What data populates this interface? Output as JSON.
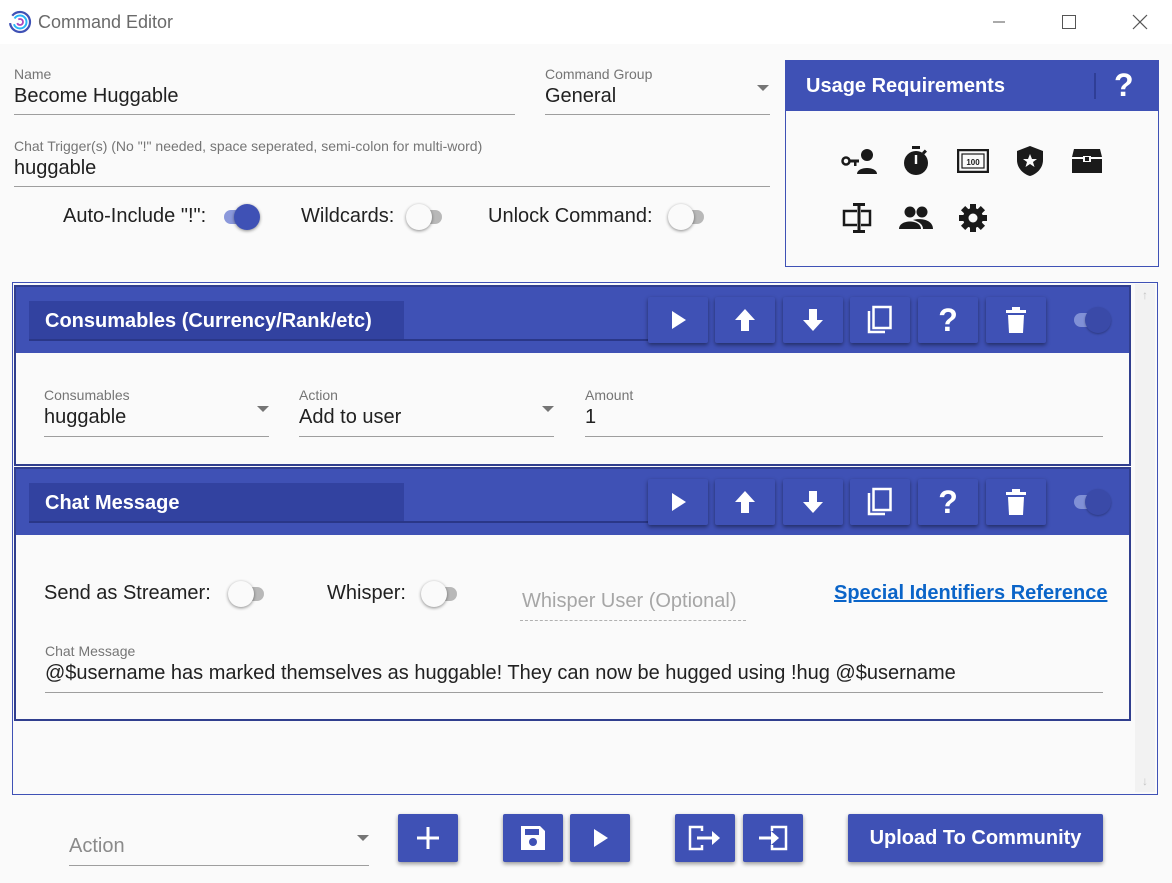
{
  "window": {
    "title": "Command Editor",
    "app_icon": "mix-it-up-logo",
    "controls": [
      "minimize-icon",
      "maximize-icon",
      "close-icon"
    ]
  },
  "command": {
    "name_label": "Name",
    "name_value": "Become Huggable",
    "group_label": "Command Group",
    "group_value": "General",
    "trigger_label": "Chat Trigger(s) (No \"!\" needed, space seperated, semi-colon for multi-word)",
    "trigger_value": "huggable",
    "options": [
      {
        "label": "Auto-Include \"!\":",
        "on": true
      },
      {
        "label": "Wildcards:",
        "on": false
      },
      {
        "label": "Unlock Command:",
        "on": false
      }
    ]
  },
  "usage_requirements": {
    "title": "Usage Requirements",
    "help": "?",
    "icons": [
      "role-icon",
      "cooldown-timer-icon",
      "currency-icon",
      "rank-badge-icon",
      "inventory-chest-icon",
      "arguments-icon",
      "threshold-users-icon",
      "settings-icon"
    ]
  },
  "actions": [
    {
      "title": "Consumables (Currency/Rank/etc)",
      "tools": [
        "play-icon",
        "move-up-icon",
        "move-down-icon",
        "duplicate-icon",
        "help-icon",
        "delete-icon"
      ],
      "enabled": true,
      "fields": {
        "consumable_label": "Consumables",
        "consumable_value": "huggable",
        "action_label": "Action",
        "action_value": "Add to user",
        "amount_label": "Amount",
        "amount_value": "1"
      }
    },
    {
      "title": "Chat Message",
      "tools": [
        "play-icon",
        "move-up-icon",
        "move-down-icon",
        "duplicate-icon",
        "help-icon",
        "delete-icon"
      ],
      "enabled": true,
      "fields": {
        "send_as_streamer_label": "Send as Streamer:",
        "send_as_streamer_on": false,
        "whisper_label": "Whisper:",
        "whisper_on": false,
        "whisper_user_placeholder": "Whisper User (Optional)",
        "special_identifiers_link": "Special Identifiers Reference",
        "message_label": "Chat Message",
        "message_value": "@$username has marked themselves as huggable! They can now be hugged using !hug @$username"
      }
    }
  ],
  "bottom_bar": {
    "action_placeholder": "Action",
    "buttons": [
      "add-icon",
      "save-icon",
      "test-run-icon",
      "export-icon",
      "import-icon"
    ],
    "upload_label": "Upload To Community"
  },
  "colors": {
    "primary": "#3f51b5",
    "primary_dark": "#303e8e",
    "link": "#0a64c8"
  }
}
